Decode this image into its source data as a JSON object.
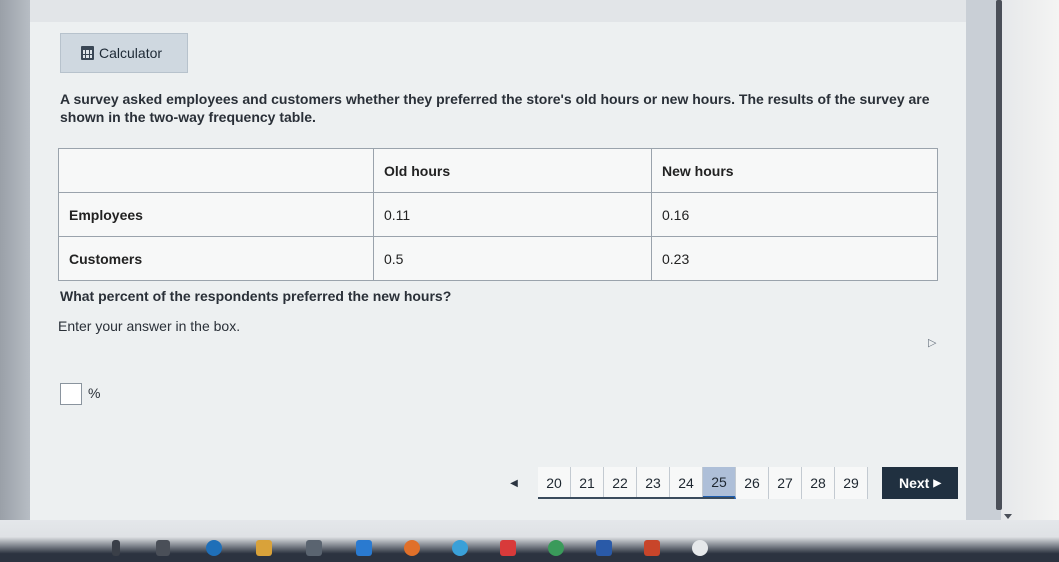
{
  "toolbar": {
    "calculator_label": "Calculator"
  },
  "question": {
    "prompt": "A survey asked employees and customers whether they preferred the store's old hours or new hours. The results of the survey are shown in the two-way frequency table.",
    "table": {
      "headers": [
        "",
        "Old hours",
        "New hours"
      ],
      "rows": [
        {
          "label": "Employees",
          "old": "0.11",
          "new": "0.16"
        },
        {
          "label": "Customers",
          "old": "0.5",
          "new": "0.23"
        }
      ]
    },
    "sub_question": "What percent of the respondents preferred the new hours?",
    "instruction": "Enter your answer in the box.",
    "answer_value": "",
    "answer_suffix": "%"
  },
  "pager": {
    "prev_icon": "triangle-left-icon",
    "pages": [
      "20",
      "21",
      "22",
      "23",
      "24",
      "25",
      "26",
      "27",
      "28",
      "29"
    ],
    "current": "25",
    "next_label": "Next"
  },
  "colors": {
    "accent": "#1f5fb0",
    "next_bg": "#203040",
    "active_page": "#aebfd8"
  }
}
